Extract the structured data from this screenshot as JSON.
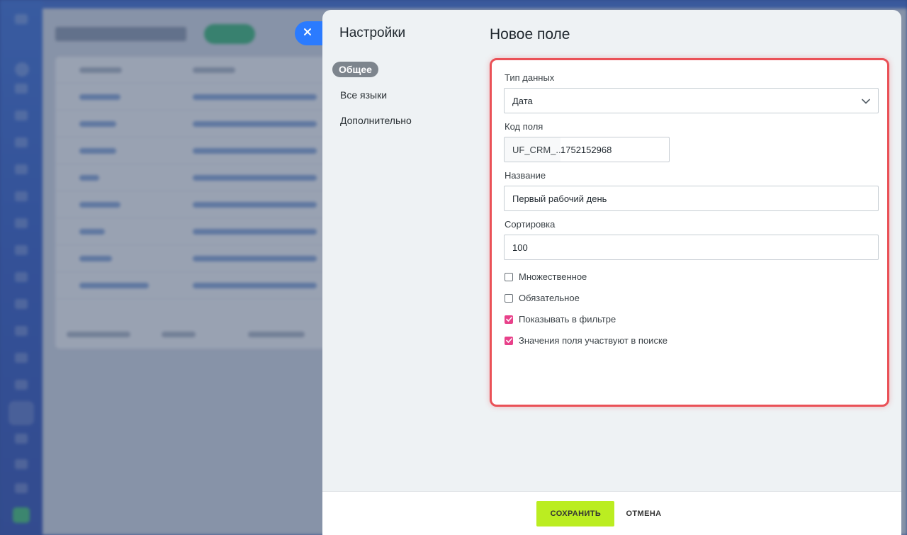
{
  "slider": {
    "nav_title": "Настройки",
    "nav_items": [
      {
        "label": "Общее",
        "active": true
      },
      {
        "label": "Все языки",
        "active": false
      },
      {
        "label": "Дополнительно",
        "active": false
      }
    ],
    "title": "Новое поле"
  },
  "form": {
    "data_type": {
      "label": "Тип данных",
      "value": "Дата"
    },
    "field_code": {
      "label": "Код поля",
      "prefix": "UF_CRM_...",
      "value": "1752152968"
    },
    "name": {
      "label": "Название",
      "value": "Первый рабочий день"
    },
    "sort": {
      "label": "Сортировка",
      "value": "100"
    },
    "checkboxes": [
      {
        "label": "Множественное",
        "checked": false
      },
      {
        "label": "Обязательное",
        "checked": false
      },
      {
        "label": "Показывать в фильтре",
        "checked": true
      },
      {
        "label": "Значения поля участвуют в поиске",
        "checked": true
      }
    ]
  },
  "footer": {
    "save_label": "СОХРАНИТЬ",
    "cancel_label": "ОТМЕНА"
  },
  "colors": {
    "accent_checkbox": "#e8418a",
    "save_button": "#bbed21",
    "highlight_border": "#ea5157",
    "close_button": "#2b7bff"
  },
  "icons": {
    "close": "close-icon",
    "dropdown": "chevron-down-icon",
    "check": "check-icon"
  }
}
